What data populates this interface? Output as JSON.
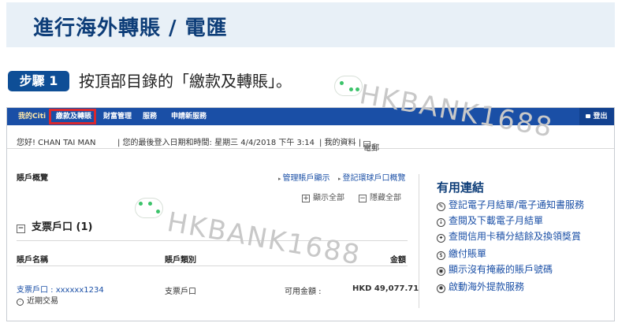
{
  "header": {
    "title": "進行海外轉賬 / 電匯"
  },
  "step": {
    "badge": "步驟 1",
    "instruction": "按頂部目錄的「繳款及轉賬」。"
  },
  "watermark": {
    "text": "HKBANK1688"
  },
  "nav": {
    "items": [
      "我的Citi",
      "繳款及轉賬",
      "財富管理",
      "服務",
      "申請新服務"
    ],
    "highlighted_index": 1,
    "logout": "登出"
  },
  "greeting": {
    "name": "您好! CHAN TAI MAN",
    "last_login": "| 您的最後登入日期和時間: 星期三 4/4/2018 下午 3:14",
    "my_info": "| 我的資料 |",
    "mail": "電郵"
  },
  "overview": {
    "title": "賬戶概覽",
    "manage_link": "管理賬戶顯示",
    "register_link": "登記環球戶口概覽",
    "expand_all": "顯示全部",
    "collapse_all": "隱藏全部"
  },
  "checking": {
    "section_title": "支票戶口 (1)",
    "columns": {
      "name": "賬戶名稱",
      "type": "賬戶類別",
      "amount": "金額"
    },
    "rows": [
      {
        "name": "支票戶口 : xxxxxx1234",
        "sub": "近期交易",
        "type": "支票戶口",
        "available_label": "可用金額 :",
        "amount": "HKD 49,077.71"
      }
    ]
  },
  "useful_links": {
    "title": "有用連結",
    "items": [
      {
        "icon": "pen-icon",
        "glyph": "✎",
        "label": "登記電子月結單/電子通知書服務"
      },
      {
        "icon": "download-icon",
        "glyph": "↓",
        "label": "查閱及下載電子月結單"
      },
      {
        "icon": "gift-icon",
        "glyph": "✦",
        "label": "查閱信用卡積分結餘及換領獎賞"
      },
      {
        "icon": "dollar-icon",
        "glyph": "$",
        "label": "繳付賬單"
      },
      {
        "icon": "eye-icon",
        "glyph": "◉",
        "label": "顯示沒有掩蔽的賬戶號碼"
      },
      {
        "icon": "globe-icon",
        "glyph": "✱",
        "label": "啟動海外提款服務"
      }
    ]
  },
  "colors": {
    "brand_blue": "#1a4fa6",
    "title_navy": "#0d3d78",
    "highlight_red": "#d8282f",
    "banner_bg": "#e8f0f7"
  }
}
